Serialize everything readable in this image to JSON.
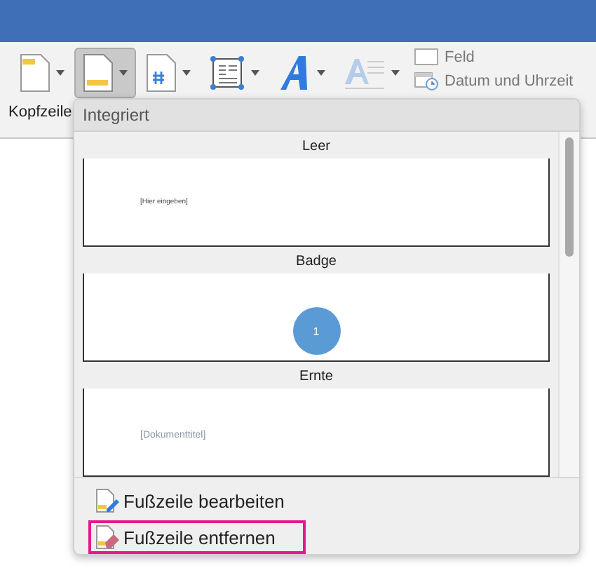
{
  "ribbon": {
    "large_buttons": [
      {
        "kind": "header",
        "label": "Kopfzeile",
        "selected": false
      },
      {
        "kind": "footer",
        "selected": true
      },
      {
        "kind": "page-number",
        "selected": false
      },
      {
        "kind": "textbox",
        "selected": false
      },
      {
        "kind": "wordart",
        "selected": false
      },
      {
        "kind": "dropcap",
        "selected": false
      }
    ],
    "small_buttons": [
      {
        "kind": "field",
        "label": "Feld"
      },
      {
        "kind": "datetime",
        "label": "Datum und Uhrzeit"
      }
    ]
  },
  "dropdown": {
    "header": "Integriert",
    "gallery": [
      {
        "kind": "blank",
        "name": "Leer",
        "text": "[Hier eingeben]"
      },
      {
        "kind": "badge",
        "name": "Badge",
        "text": "1"
      },
      {
        "kind": "title",
        "name": "Ernte",
        "text": "[Dokumenttitel]"
      }
    ],
    "actions": [
      {
        "kind": "edit",
        "label": "Fußzeile bearbeiten",
        "highlighted": false
      },
      {
        "kind": "remove",
        "label": "Fußzeile entfernen",
        "highlighted": true
      }
    ]
  }
}
